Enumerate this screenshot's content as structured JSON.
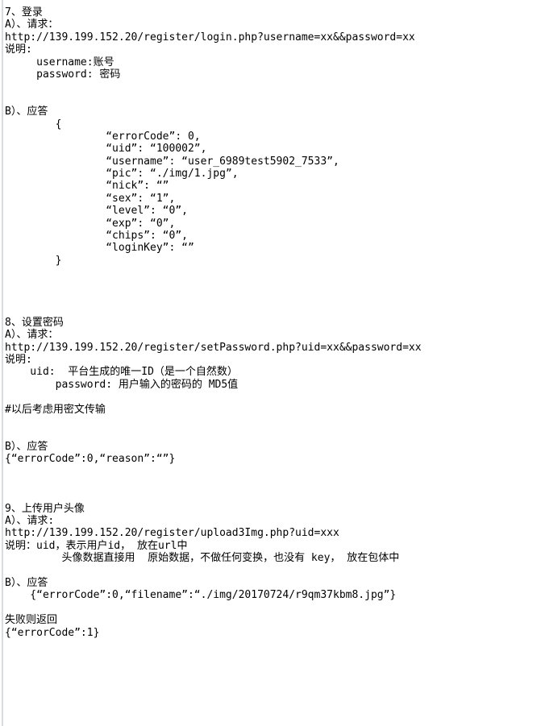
{
  "document": {
    "type": "plain-text-api-documentation",
    "gutter_color": "#d3dde3",
    "text_color": "#000000",
    "background_color": "#ffffff",
    "sections": [
      {
        "id": "section-7",
        "heading": "7、登录",
        "lines": [
          "7、登录",
          "A）、请求：",
          "http://139.199.152.20/register/login.php?username=xx&&password=xx",
          "说明:",
          "     username:账号",
          "     password: 密码",
          "",
          "",
          "B）、应答",
          "        {",
          "                “errorCode”: 0,",
          "                “uid”: “100002”,",
          "                “username”: “user_6989test5902_7533”,",
          "                “pic”: “./img/1.jpg”,",
          "                “nick”: “”",
          "                “sex”: “1”,",
          "                “level”: “0”,",
          "                “exp”: “0”,",
          "                “chips”: “0”,",
          "                “loginKey”: “”",
          "        }"
        ]
      },
      {
        "id": "section-8",
        "heading": "8、设置密码",
        "lines": [
          "8、设置密码",
          "A）、请求：",
          "http://139.199.152.20/register/setPassword.php?uid=xx&&password=xx",
          "说明:",
          "    uid:  平台生成的唯一ID（是一个自然数）",
          "        password: 用户输入的密码的 MD5值",
          "",
          "#以后考虑用密文传输",
          "",
          "",
          "B）、应答",
          "{“errorCode”:0,“reason”:“”}"
        ]
      },
      {
        "id": "section-9",
        "heading": "9、上传用户头像",
        "lines": [
          "9、上传用户头像",
          "A）、请求:",
          "http://139.199.152.20/register/upload3Img.php?uid=xxx",
          "说明：uid，表示用户id， 放在url中",
          "         头像数据直接用  原始数据，不做任何变换，也没有 key， 放在包体中",
          "",
          "B）、应答",
          "    {“errorCode”:0,“filename”:“./img/20170724/r9qm37kbm8.jpg”}",
          "",
          "失败则返回",
          "{“errorCode”:1}"
        ]
      }
    ],
    "spacers": {
      "after_section_7": 4,
      "after_section_8": 3
    }
  }
}
